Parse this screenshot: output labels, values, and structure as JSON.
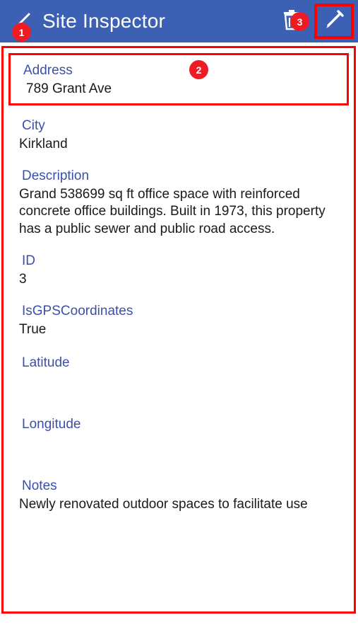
{
  "header": {
    "title": "Site Inspector",
    "background_color": "#3c61b4",
    "left_icon": "pencil-icon",
    "actions": [
      {
        "icon": "trash-icon",
        "name": "delete-button"
      },
      {
        "icon": "pencil-icon",
        "name": "edit-button",
        "highlighted": true
      }
    ]
  },
  "badges": [
    {
      "label": "1",
      "target": "header-left-pencil-icon"
    },
    {
      "label": "2",
      "target": "address-field"
    },
    {
      "label": "3",
      "target": "delete-button"
    }
  ],
  "accent": {
    "highlight_color": "#ff0000",
    "label_color": "#3a50a8",
    "value_color": "#1a1a1a"
  },
  "fields": [
    {
      "label": "Address",
      "value": "789 Grant Ave"
    },
    {
      "label": "City",
      "value": "Kirkland"
    },
    {
      "label": "Description",
      "value": "Grand 538699 sq ft office space with reinforced concrete office buildings. Built in 1973, this property has a public sewer and public road access."
    },
    {
      "label": "ID",
      "value": "3"
    },
    {
      "label": "IsGPSCoordinates",
      "value": "True"
    },
    {
      "label": "Latitude",
      "value": ""
    },
    {
      "label": "Longitude",
      "value": ""
    },
    {
      "label": "Notes",
      "value": "Newly renovated outdoor spaces to facilitate use"
    }
  ]
}
